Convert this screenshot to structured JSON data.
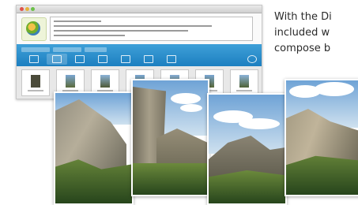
{
  "caption": {
    "lines": [
      "With the Di",
      "included w",
      "compose b"
    ]
  },
  "icons": {
    "logo": "app-logo-icon",
    "close": "window-close-icon",
    "minimize": "window-minimize-icon",
    "zoom": "window-zoom-icon"
  },
  "colors": {
    "toolbar_blue": "#1c7fc0",
    "window_bg": "#f4f4f4",
    "photo_border": "#ffffff"
  }
}
